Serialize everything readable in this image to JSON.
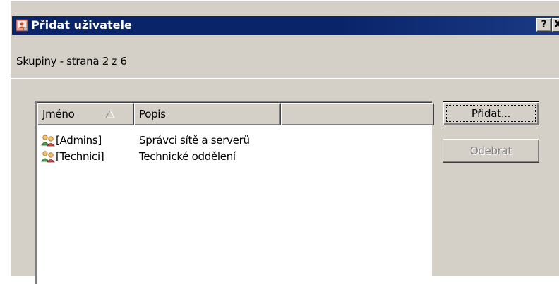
{
  "window": {
    "title": "Přidat uživatele",
    "help_label": "?",
    "close_label": "X"
  },
  "subtitle": "Skupiny - strana 2 z 6",
  "list": {
    "columns": [
      "Jméno",
      "Popis",
      ""
    ],
    "sort_column": "Jméno",
    "sort_direction": "ascending",
    "rows": [
      {
        "name": "[Admins]",
        "description": "Správci sítě a serverů"
      },
      {
        "name": "[Technici]",
        "description": "Technické oddělení"
      }
    ]
  },
  "buttons": {
    "add_label": "Přidat...",
    "remove_label": "Odebrat",
    "remove_enabled": false
  },
  "colors": {
    "titlebar": "#0a246a",
    "face": "#d4d0c8",
    "disabled_text": "#808080"
  },
  "icons": {
    "app": "add-user-icon",
    "group": "user-group-icon",
    "sort": "sort-ascending-icon"
  }
}
